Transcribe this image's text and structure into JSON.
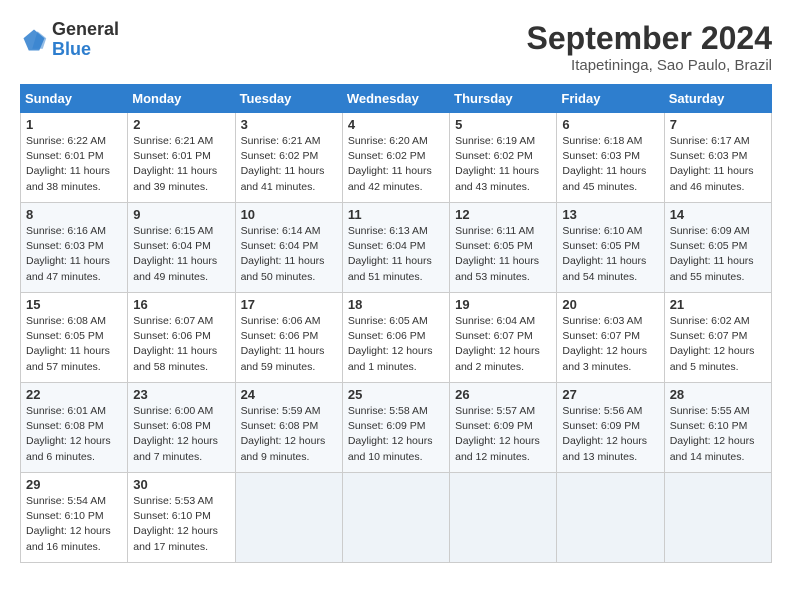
{
  "header": {
    "logo_line1": "General",
    "logo_line2": "Blue",
    "month_title": "September 2024",
    "subtitle": "Itapetininga, Sao Paulo, Brazil"
  },
  "days_of_week": [
    "Sunday",
    "Monday",
    "Tuesday",
    "Wednesday",
    "Thursday",
    "Friday",
    "Saturday"
  ],
  "weeks": [
    [
      {
        "day": 1,
        "sunrise": "6:22 AM",
        "sunset": "6:01 PM",
        "daylight": "11 hours and 38 minutes."
      },
      {
        "day": 2,
        "sunrise": "6:21 AM",
        "sunset": "6:01 PM",
        "daylight": "11 hours and 39 minutes."
      },
      {
        "day": 3,
        "sunrise": "6:21 AM",
        "sunset": "6:02 PM",
        "daylight": "11 hours and 41 minutes."
      },
      {
        "day": 4,
        "sunrise": "6:20 AM",
        "sunset": "6:02 PM",
        "daylight": "11 hours and 42 minutes."
      },
      {
        "day": 5,
        "sunrise": "6:19 AM",
        "sunset": "6:02 PM",
        "daylight": "11 hours and 43 minutes."
      },
      {
        "day": 6,
        "sunrise": "6:18 AM",
        "sunset": "6:03 PM",
        "daylight": "11 hours and 45 minutes."
      },
      {
        "day": 7,
        "sunrise": "6:17 AM",
        "sunset": "6:03 PM",
        "daylight": "11 hours and 46 minutes."
      }
    ],
    [
      {
        "day": 8,
        "sunrise": "6:16 AM",
        "sunset": "6:03 PM",
        "daylight": "11 hours and 47 minutes."
      },
      {
        "day": 9,
        "sunrise": "6:15 AM",
        "sunset": "6:04 PM",
        "daylight": "11 hours and 49 minutes."
      },
      {
        "day": 10,
        "sunrise": "6:14 AM",
        "sunset": "6:04 PM",
        "daylight": "11 hours and 50 minutes."
      },
      {
        "day": 11,
        "sunrise": "6:13 AM",
        "sunset": "6:04 PM",
        "daylight": "11 hours and 51 minutes."
      },
      {
        "day": 12,
        "sunrise": "6:11 AM",
        "sunset": "6:05 PM",
        "daylight": "11 hours and 53 minutes."
      },
      {
        "day": 13,
        "sunrise": "6:10 AM",
        "sunset": "6:05 PM",
        "daylight": "11 hours and 54 minutes."
      },
      {
        "day": 14,
        "sunrise": "6:09 AM",
        "sunset": "6:05 PM",
        "daylight": "11 hours and 55 minutes."
      }
    ],
    [
      {
        "day": 15,
        "sunrise": "6:08 AM",
        "sunset": "6:05 PM",
        "daylight": "11 hours and 57 minutes."
      },
      {
        "day": 16,
        "sunrise": "6:07 AM",
        "sunset": "6:06 PM",
        "daylight": "11 hours and 58 minutes."
      },
      {
        "day": 17,
        "sunrise": "6:06 AM",
        "sunset": "6:06 PM",
        "daylight": "11 hours and 59 minutes."
      },
      {
        "day": 18,
        "sunrise": "6:05 AM",
        "sunset": "6:06 PM",
        "daylight": "12 hours and 1 minute."
      },
      {
        "day": 19,
        "sunrise": "6:04 AM",
        "sunset": "6:07 PM",
        "daylight": "12 hours and 2 minutes."
      },
      {
        "day": 20,
        "sunrise": "6:03 AM",
        "sunset": "6:07 PM",
        "daylight": "12 hours and 3 minutes."
      },
      {
        "day": 21,
        "sunrise": "6:02 AM",
        "sunset": "6:07 PM",
        "daylight": "12 hours and 5 minutes."
      }
    ],
    [
      {
        "day": 22,
        "sunrise": "6:01 AM",
        "sunset": "6:08 PM",
        "daylight": "12 hours and 6 minutes."
      },
      {
        "day": 23,
        "sunrise": "6:00 AM",
        "sunset": "6:08 PM",
        "daylight": "12 hours and 7 minutes."
      },
      {
        "day": 24,
        "sunrise": "5:59 AM",
        "sunset": "6:08 PM",
        "daylight": "12 hours and 9 minutes."
      },
      {
        "day": 25,
        "sunrise": "5:58 AM",
        "sunset": "6:09 PM",
        "daylight": "12 hours and 10 minutes."
      },
      {
        "day": 26,
        "sunrise": "5:57 AM",
        "sunset": "6:09 PM",
        "daylight": "12 hours and 12 minutes."
      },
      {
        "day": 27,
        "sunrise": "5:56 AM",
        "sunset": "6:09 PM",
        "daylight": "12 hours and 13 minutes."
      },
      {
        "day": 28,
        "sunrise": "5:55 AM",
        "sunset": "6:10 PM",
        "daylight": "12 hours and 14 minutes."
      }
    ],
    [
      {
        "day": 29,
        "sunrise": "5:54 AM",
        "sunset": "6:10 PM",
        "daylight": "12 hours and 16 minutes."
      },
      {
        "day": 30,
        "sunrise": "5:53 AM",
        "sunset": "6:10 PM",
        "daylight": "12 hours and 17 minutes."
      },
      null,
      null,
      null,
      null,
      null
    ]
  ]
}
